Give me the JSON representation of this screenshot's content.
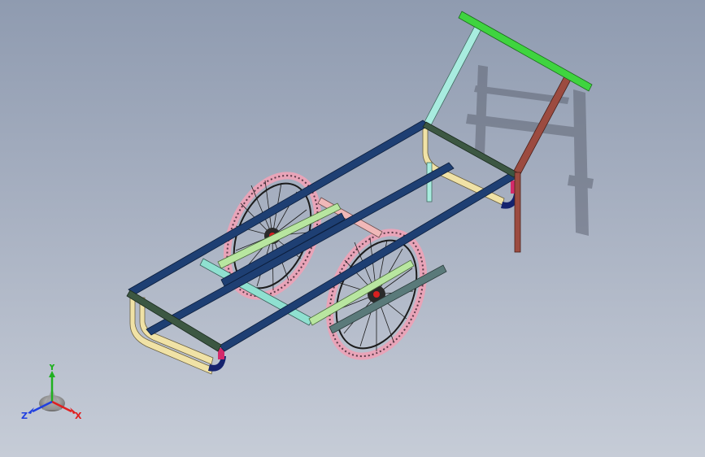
{
  "model": {
    "colors": {
      "frame_blue": "#1e3f73",
      "frame_dark_green": "#3c5742",
      "handle_green": "#3fd43f",
      "handle_light_cyan": "#a8ecdf",
      "handle_brown": "#9c4b40",
      "side_tan": "#f0e2a6",
      "foot_navy": "#15236e",
      "tire_pink": "#e8a4b8",
      "spoke_dark": "#1c1c1c",
      "axle_green": "#b8e6a0",
      "cross_teal": "#8fe0d0",
      "hub_red": "#d82020",
      "brace_pink": "#f0b8b8",
      "shadow_gray": "#6b7180"
    }
  },
  "triad": {
    "x_label": "X",
    "y_label": "Y",
    "z_label": "Z",
    "x_color": "#e02020",
    "y_color": "#20b020",
    "z_color": "#2040e0"
  }
}
